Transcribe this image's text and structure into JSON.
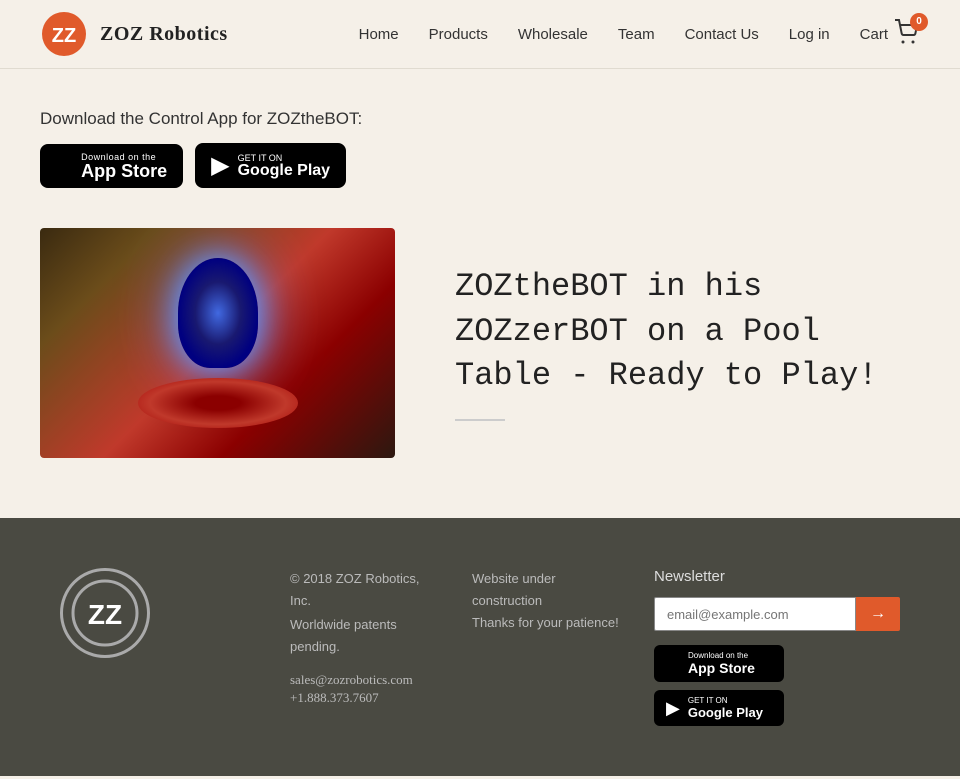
{
  "header": {
    "logo_text": "ZOZ Robotics",
    "nav": {
      "home": "Home",
      "products": "Products",
      "wholesale": "Wholesale",
      "team": "Team",
      "contact": "Contact Us",
      "login": "Log in",
      "cart": "Cart",
      "cart_count": "0"
    }
  },
  "main": {
    "download_label": "Download the Control App for ZOZtheBOT:",
    "app_store": {
      "sub": "Download on the",
      "main": "App Store"
    },
    "google_play": {
      "sub": "GET IT ON",
      "main": "Google Play"
    },
    "robot_title": "ZOZtheBOT in his ZOZzerBOT on a Pool Table - Ready to Play!"
  },
  "footer": {
    "copyright1": "© 2018 ZOZ Robotics, Inc.",
    "copyright2": "Worldwide patents pending.",
    "email": "sales@zozrobotics.com",
    "phone": "+1.888.373.7607",
    "status1": "Website under construction",
    "status2": "Thanks for your patience!",
    "newsletter_label": "Newsletter",
    "newsletter_placeholder": "email@example.com",
    "newsletter_submit": "→",
    "app_store_sub": "Download on the",
    "app_store_main": "App Store",
    "google_play_sub": "GET IT ON",
    "google_play_main": "Google Play"
  }
}
